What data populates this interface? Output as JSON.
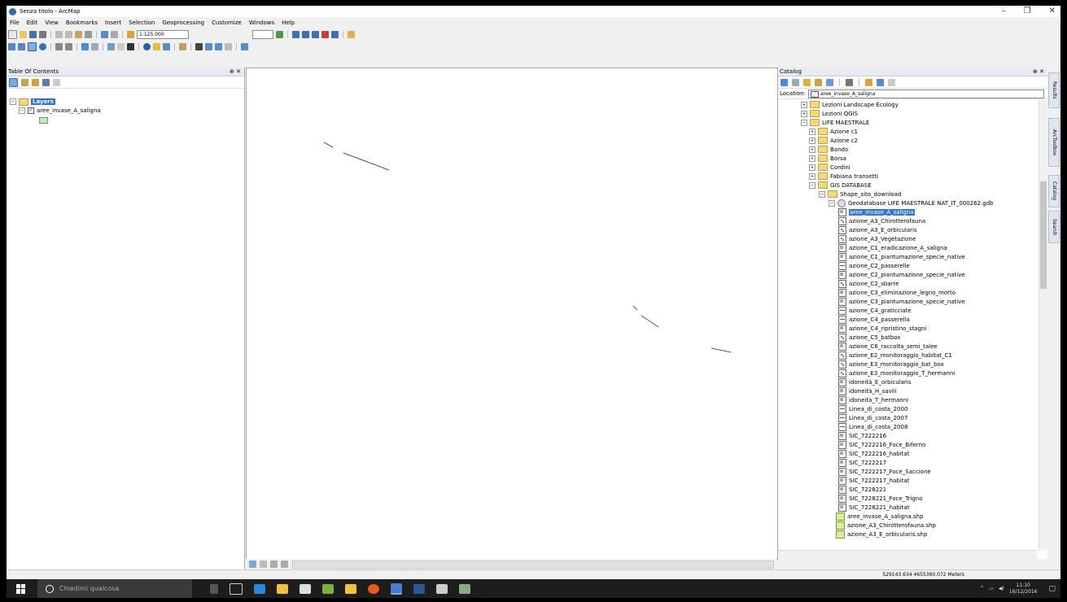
{
  "window": {
    "title": "Senza titolo - ArcMap",
    "minimize": "–",
    "maximize": "❐",
    "close": "✕"
  },
  "menu": [
    "File",
    "Edit",
    "View",
    "Bookmarks",
    "Insert",
    "Selection",
    "Geoprocessing",
    "Customize",
    "Windows",
    "Help"
  ],
  "toolbar": {
    "scale": "1:125.000"
  },
  "toc": {
    "title": "Table Of Contents",
    "pin": "⊕ ✕",
    "group_label": "Layers",
    "layer_label": "aree_invase_A_saligna"
  },
  "catalog": {
    "title": "Catalog",
    "pin": "⊕ ✕",
    "location_label": "Location:",
    "location_value": "aree_invase_A_saligna",
    "tree": [
      {
        "label": "Lezioni Landscape Ecology",
        "kind": "folder",
        "level": 0,
        "exp": "+"
      },
      {
        "label": "Lezioni QGIS",
        "kind": "folder",
        "level": 0,
        "exp": "+"
      },
      {
        "label": "LIFE MAESTRALE",
        "kind": "folder",
        "level": 0,
        "exp": "−"
      },
      {
        "label": "Azione c1",
        "kind": "folder",
        "level": 1,
        "exp": "+"
      },
      {
        "label": "Azione c2",
        "kind": "folder",
        "level": 1,
        "exp": "+"
      },
      {
        "label": "Bando",
        "kind": "folder",
        "level": 1,
        "exp": "+"
      },
      {
        "label": "Borsa",
        "kind": "folder",
        "level": 1,
        "exp": "+"
      },
      {
        "label": "Cordini",
        "kind": "folder",
        "level": 1,
        "exp": "+"
      },
      {
        "label": "Fabiana transetti",
        "kind": "folder",
        "level": 1,
        "exp": "+"
      },
      {
        "label": "GIS DATABASE",
        "kind": "folder",
        "level": 1,
        "exp": "−"
      },
      {
        "label": "Shape_sito_download",
        "kind": "folder",
        "level": 2,
        "exp": "−"
      },
      {
        "label": "Geodatabase LIFE MAESTRALE NAT_IT_000262.gdb",
        "kind": "gdb",
        "level": 3,
        "exp": "−"
      },
      {
        "label": "aree_invase_A_saligna",
        "kind": "poly",
        "level": 4,
        "selected": true
      },
      {
        "label": "azione_A3_Chirotterofauna",
        "kind": "point",
        "level": 4
      },
      {
        "label": "azione_A3_E_orbicularis",
        "kind": "point",
        "level": 4
      },
      {
        "label": "azione_A3_Vegetazione",
        "kind": "point",
        "level": 4
      },
      {
        "label": "azione_C1_eradicazione_A_saligna",
        "kind": "poly",
        "level": 4
      },
      {
        "label": "azione_C1_piantumazione_specie_native",
        "kind": "poly",
        "level": 4
      },
      {
        "label": "azione_C2_passerelle",
        "kind": "line",
        "level": 4
      },
      {
        "label": "azione_C2_piantumazione_specie_native",
        "kind": "poly",
        "level": 4
      },
      {
        "label": "azione_C2_sbarre",
        "kind": "point",
        "level": 4
      },
      {
        "label": "azione_C3_eliminazione_legno_morto",
        "kind": "poly",
        "level": 4
      },
      {
        "label": "azione_C3_piantumazione_specie_native",
        "kind": "poly",
        "level": 4
      },
      {
        "label": "azione_C4_graticciate",
        "kind": "line",
        "level": 4
      },
      {
        "label": "azione_C4_passerella",
        "kind": "line",
        "level": 4
      },
      {
        "label": "azione_C4_ripristino_stagni",
        "kind": "poly",
        "level": 4
      },
      {
        "label": "azione_C5_batbox",
        "kind": "point",
        "level": 4
      },
      {
        "label": "azione_C6_raccolta_semi_talee",
        "kind": "poly",
        "level": 4
      },
      {
        "label": "azione_E2_monitoraggio_habitat_C1",
        "kind": "point",
        "level": 4
      },
      {
        "label": "azione_E3_monitoraggio_bat_box",
        "kind": "point",
        "level": 4
      },
      {
        "label": "azione_E3_monitoraggio_T_hermanni",
        "kind": "point",
        "level": 4
      },
      {
        "label": "idoneità_E_orbicularis",
        "kind": "poly",
        "level": 4
      },
      {
        "label": "idoneità_H_saviii",
        "kind": "poly",
        "level": 4
      },
      {
        "label": "idoneità_T_hermanni",
        "kind": "poly",
        "level": 4
      },
      {
        "label": "Linea_di_costa_2000",
        "kind": "line",
        "level": 4
      },
      {
        "label": "Linea_di_costa_2007",
        "kind": "line",
        "level": 4
      },
      {
        "label": "Linea_di_costa_2008",
        "kind": "line",
        "level": 4
      },
      {
        "label": "SIC_7222216",
        "kind": "poly",
        "level": 4
      },
      {
        "label": "SIC_7222216_Foce_Biferno",
        "kind": "poly",
        "level": 4
      },
      {
        "label": "SIC_7222216_habitat",
        "kind": "poly",
        "level": 4
      },
      {
        "label": "SIC_7222217",
        "kind": "poly",
        "level": 4
      },
      {
        "label": "SIC_7222217_Foce_Saccione",
        "kind": "poly",
        "level": 4
      },
      {
        "label": "SIC_7222217_habitat",
        "kind": "poly",
        "level": 4
      },
      {
        "label": "SIC_7228221",
        "kind": "poly",
        "level": 4
      },
      {
        "label": "SIC_7228221_Foce_Trigno",
        "kind": "poly",
        "level": 4
      },
      {
        "label": "SIC_7228221_habitat",
        "kind": "poly",
        "level": 4
      },
      {
        "label": "aree_invase_A_saligna.shp",
        "kind": "shp",
        "level": 3
      },
      {
        "label": "azione_A3_Chirotterofauna.shp",
        "kind": "shp",
        "level": 3
      },
      {
        "label": "azione_A3_E_orbicularis.shp",
        "kind": "shp",
        "level": 3
      }
    ]
  },
  "sidetabs": [
    "Results",
    "ArcToolbox",
    "Catalog",
    "Search"
  ],
  "status": {
    "coords": "529143.634  4655360.072 Meters"
  },
  "taskbar": {
    "search_placeholder": "Chiedimi qualcosa",
    "time": "11:10",
    "date": "16/12/2016"
  },
  "colors": {
    "selection": "#3375d6",
    "layer_fill": "#c7e6c7",
    "taskbar": "#1d1d1d"
  }
}
